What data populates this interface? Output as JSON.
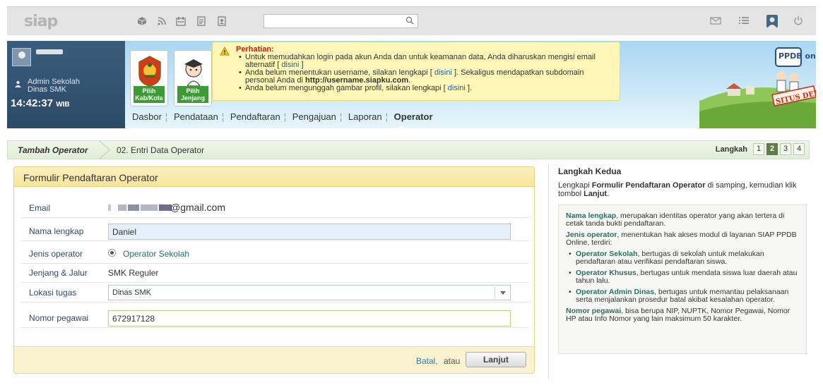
{
  "app": {
    "logo": "siap"
  },
  "topbar": {
    "search_placeholder": "",
    "icons": [
      "box-icon",
      "rss-icon",
      "calendar-icon",
      "document-icon",
      "contact-card-icon"
    ],
    "right_icons": [
      "mail-icon",
      "list-icon",
      "user-avatar-icon",
      "power-icon"
    ]
  },
  "user": {
    "role_line1": "Admin Sekolah",
    "role_line2": "Dinas SMK",
    "time": "14:42:37",
    "time_zone": "WIB"
  },
  "selectors": [
    {
      "label_line1": "Pilih",
      "label_line2": "Kab/Kota"
    },
    {
      "label_line1": "Pilih",
      "label_line2": "Jenjang"
    }
  ],
  "alert": {
    "title": "Perhatian:",
    "items": [
      {
        "text": "Untuk memudahkan login pada akun Anda dan untuk keamanan data, Anda diharuskan mengisi email alternatif [",
        "link": "disini",
        "after": "]"
      },
      {
        "text": "Anda belum menentukan username, silakan lengkapi [",
        "link": "disini",
        "after": "]. Sekaligus mendapatkan subdomain personal Anda di",
        "bold": "http://username.siapku.com",
        "end": "."
      },
      {
        "text": "Anda belum mengunggah gambar profil, silakan lengkapi [",
        "link": "disini",
        "after": "]."
      }
    ]
  },
  "nav": {
    "items": [
      "Dasbor",
      "Pendataan",
      "Pendaftaran",
      "Pengajuan",
      "Laporan",
      "Operator"
    ],
    "active": "Operator"
  },
  "banner": {
    "badge": "PPDB online",
    "stamp": "SITUS DEMO"
  },
  "breadcrumb": {
    "parent": "Tambah Operator",
    "current": "02. Entri Data Operator",
    "steps_label": "Langkah",
    "steps": [
      "1",
      "2",
      "3",
      "4"
    ],
    "active_step": "2"
  },
  "form": {
    "title": "Formulir Pendaftaran Operator",
    "fields": {
      "email": {
        "label": "Email",
        "value": "@gmail.com"
      },
      "nama": {
        "label": "Nama lengkap",
        "value": "Daniel"
      },
      "jenis": {
        "label": "Jenis operator",
        "value": "Operator Sekolah"
      },
      "jenjang": {
        "label": "Jenjang & Jalur",
        "value": "SMK Reguler"
      },
      "lokasi": {
        "label": "Lokasi tugas",
        "value": "Dinas SMK"
      },
      "nomor": {
        "label": "Nomor pegawai",
        "value": "672917128"
      }
    },
    "cancel_label": "Batal,",
    "or_label": "atau",
    "submit_label": "Lanjut"
  },
  "side": {
    "title": "Langkah Kedua",
    "intro_a": "Lengkapi",
    "intro_b": "Formulir Pendaftaran Operator",
    "intro_c": "di samping, kemudian klik tombol",
    "intro_d": "Lanjut",
    "intro_e": ".",
    "p1_term": "Nama lengkap",
    "p1_text": ", merupakan identitas operator yang akan tertera di cetak tanda bukti pendaftaran.",
    "p2_term": "Jenis operator",
    "p2_text": ", menentukan hak akses modul di layanan SIAP PPDB Online, terdiri:",
    "bullets": [
      {
        "term": "Operator Sekolah",
        "text": ", bertugas di sekolah untuk melakukan pendaftaran atau verifikasi pendaftaran siswa."
      },
      {
        "term": "Operator Khusus",
        "text": ", bertugas untuk mendata siswa luar daerah atau tahun lalu."
      },
      {
        "term": "Operator Admin Dinas",
        "text": ", bertugas untuk memantau pelaksanaan serta menjalankan prosedur batal akibat kesalahan operator."
      }
    ],
    "p3_term": "Nomor pegawai",
    "p3_text": ", bisa berupa NIP, NUPTK, Nomor Pegawai, Nomor HP atau Info Nomor yang lain maksimum 50 karakter."
  },
  "colors": {
    "accent_green": "#3c9b37",
    "link_blue": "#20639f",
    "alert_title": "#c4220b",
    "term_teal": "#2a6f61"
  }
}
